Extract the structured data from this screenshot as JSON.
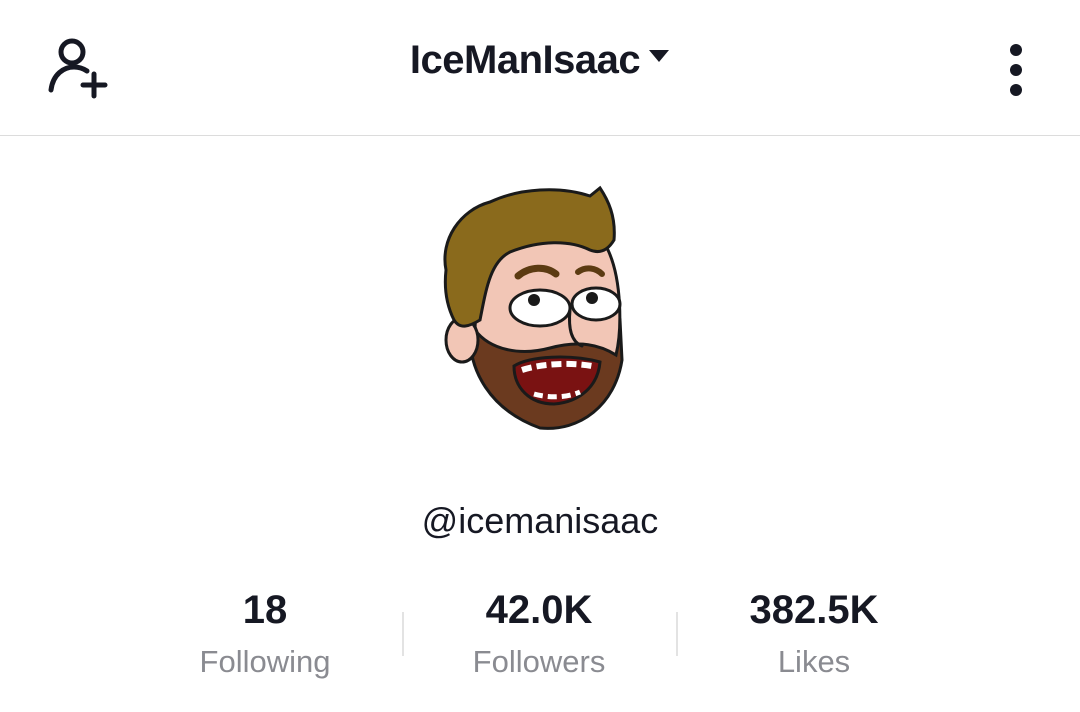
{
  "header": {
    "username": "IceManIsaac",
    "add_friend_icon": "person-add-icon",
    "switch_account_icon": "caret-down-icon",
    "more_icon": "vertical-ellipsis-icon"
  },
  "profile": {
    "avatar": "cartoon-bearded-man-avatar",
    "handle": "@icemanisaac"
  },
  "stats": [
    {
      "value": "18",
      "label": "Following"
    },
    {
      "value": "42.0K",
      "label": "Followers"
    },
    {
      "value": "382.5K",
      "label": "Likes"
    }
  ],
  "colors": {
    "text_primary": "#161823",
    "text_secondary": "#8a8b91",
    "divider": "#dcdcdc"
  }
}
